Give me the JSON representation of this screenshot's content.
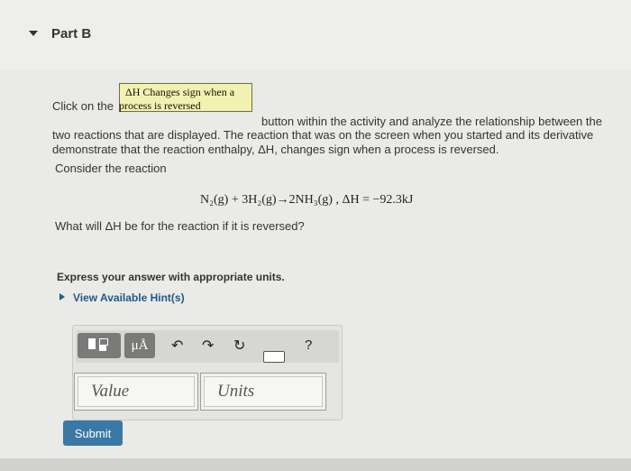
{
  "part": {
    "title": "Part B"
  },
  "activity_button": {
    "line1": "ΔH Changes sign when a",
    "line2": "process is reversed"
  },
  "instructions": {
    "before": "Click on the",
    "after": "button within the activity and analyze the relationship between the",
    "line2": "two reactions that are displayed. The reaction that was on the screen when you started and its derivative",
    "line3": "demonstrate that the reaction enthalpy, ΔH, changes sign when a process is reversed."
  },
  "consider": "Consider the reaction",
  "equation": "N₂(g) + 3H₂(g)→2NH₃(g) , ΔH = −92.3kJ",
  "question": "What will ΔH be for the reaction if it is reversed?",
  "express": "Express your answer with appropriate units.",
  "hints": {
    "label": "View Available Hint(s)"
  },
  "toolbar": {
    "template_icon": "templates-icon",
    "units_label": "μÅ",
    "undo_icon": "undo-icon",
    "redo_icon": "redo-icon",
    "reset_icon": "reset-icon",
    "keyboard_icon": "keyboard-icon",
    "help_label": "?"
  },
  "inputs": {
    "value_placeholder": "Value",
    "units_placeholder": "Units"
  },
  "submit": {
    "label": "Submit"
  },
  "colors": {
    "accent": "#3a78a6",
    "link": "#23588a",
    "activity_button_bg": "#f3f1b0"
  }
}
